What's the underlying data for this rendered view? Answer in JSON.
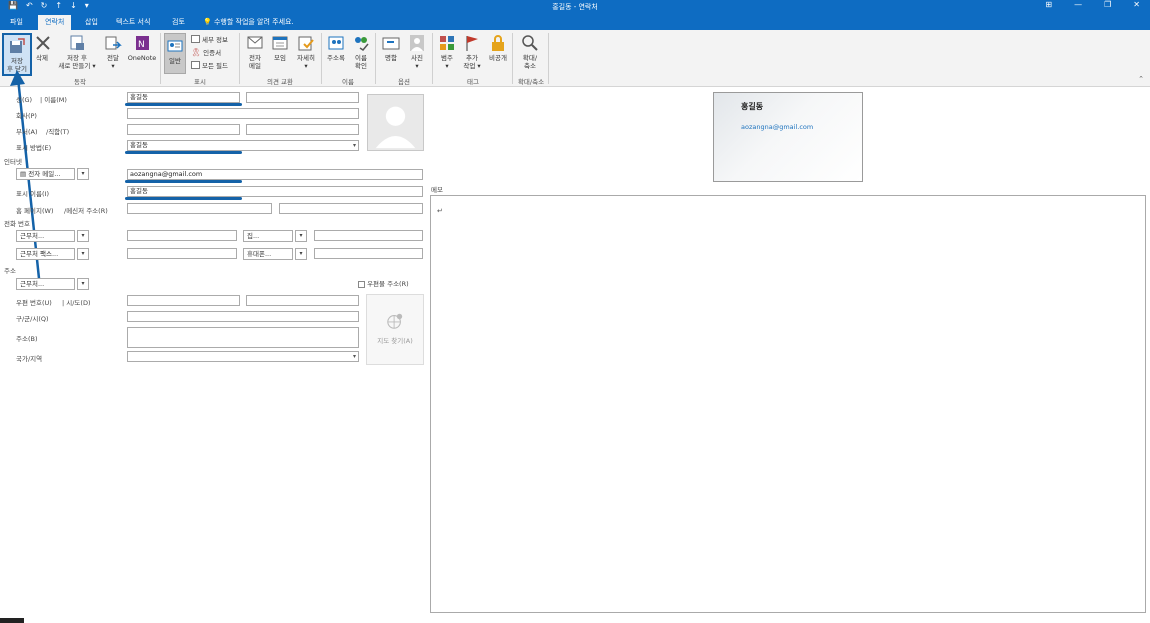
{
  "window": {
    "title": "홍길동 - 연락처"
  },
  "tabs": [
    {
      "label": "파일"
    },
    {
      "label": "연락처"
    },
    {
      "label": "삽입"
    },
    {
      "label": "텍스트 서식"
    },
    {
      "label": "검토"
    }
  ],
  "tell_me": "수행할 작업을 알려 주세요.",
  "ribbon": {
    "save_close": [
      "저장",
      "후 닫기"
    ],
    "delete": "삭제",
    "save_new": [
      "저장 후",
      "새로 만들기 ▾"
    ],
    "forward": [
      "전달",
      "▾"
    ],
    "onenote": "OneNote",
    "group_actions": "동작",
    "general": "일반",
    "details": "세부 정보",
    "certificates": "인증서",
    "all_fields": "모든 필드",
    "group_show": "표시",
    "email": [
      "전자",
      "메일"
    ],
    "meeting": "모임",
    "more": [
      "자세히",
      "▾"
    ],
    "group_communicate": "의견 교환",
    "address_book": "주소록",
    "check_names": [
      "이름",
      "확인"
    ],
    "group_names": "이름",
    "business_card": "명함",
    "picture": [
      "사진",
      "▾"
    ],
    "group_options": "옵션",
    "categorize": [
      "범주",
      "▾"
    ],
    "follow_up": [
      "추가",
      "작업 ▾"
    ],
    "private": "비공개",
    "group_tags": "태그",
    "zoom": [
      "확대/",
      "축소"
    ],
    "group_zoom": "확대/축소"
  },
  "form": {
    "label_fullname": "성(G)",
    "label_name": "| 이름(M)",
    "label_company": "회사(P)",
    "label_dept": "부서(A)",
    "label_jobtitle": "/직함(T)",
    "label_fileas": "표시 방법(E)",
    "section_internet": "인터넷",
    "email_type": "전자 메일...",
    "label_display": "표시 이름(I)",
    "label_web": "홈 페이지(W)",
    "label_im": "/메신저 주소(R)",
    "section_phone": "전화 번호",
    "phone1": "근무처...",
    "phone2": "집...",
    "phone3": "근무처 팩스...",
    "phone4": "휴대폰...",
    "section_address": "주소",
    "address_type": "근무처...",
    "mailing_checkbox": "우편물 주소(R)",
    "label_zip": "우편 번호(U)",
    "label_city": "| 시/도(D)",
    "label_district": "구/군/시(Q)",
    "label_street": "주소(B)",
    "label_country": "국가/지역",
    "map_button": "지도 찾기(A)",
    "label_notes": "메모",
    "value_surname": "홍길동",
    "value_fileas": "홍길동",
    "value_email": "aozangna@gmail.com",
    "value_display": "홍길동",
    "notes_cursor": "↵"
  },
  "card": {
    "name": "홍길동",
    "email": "aozangna@gmail.com"
  },
  "colors": {
    "brand": "#0e6cc2",
    "annotation": "#1462a8"
  }
}
